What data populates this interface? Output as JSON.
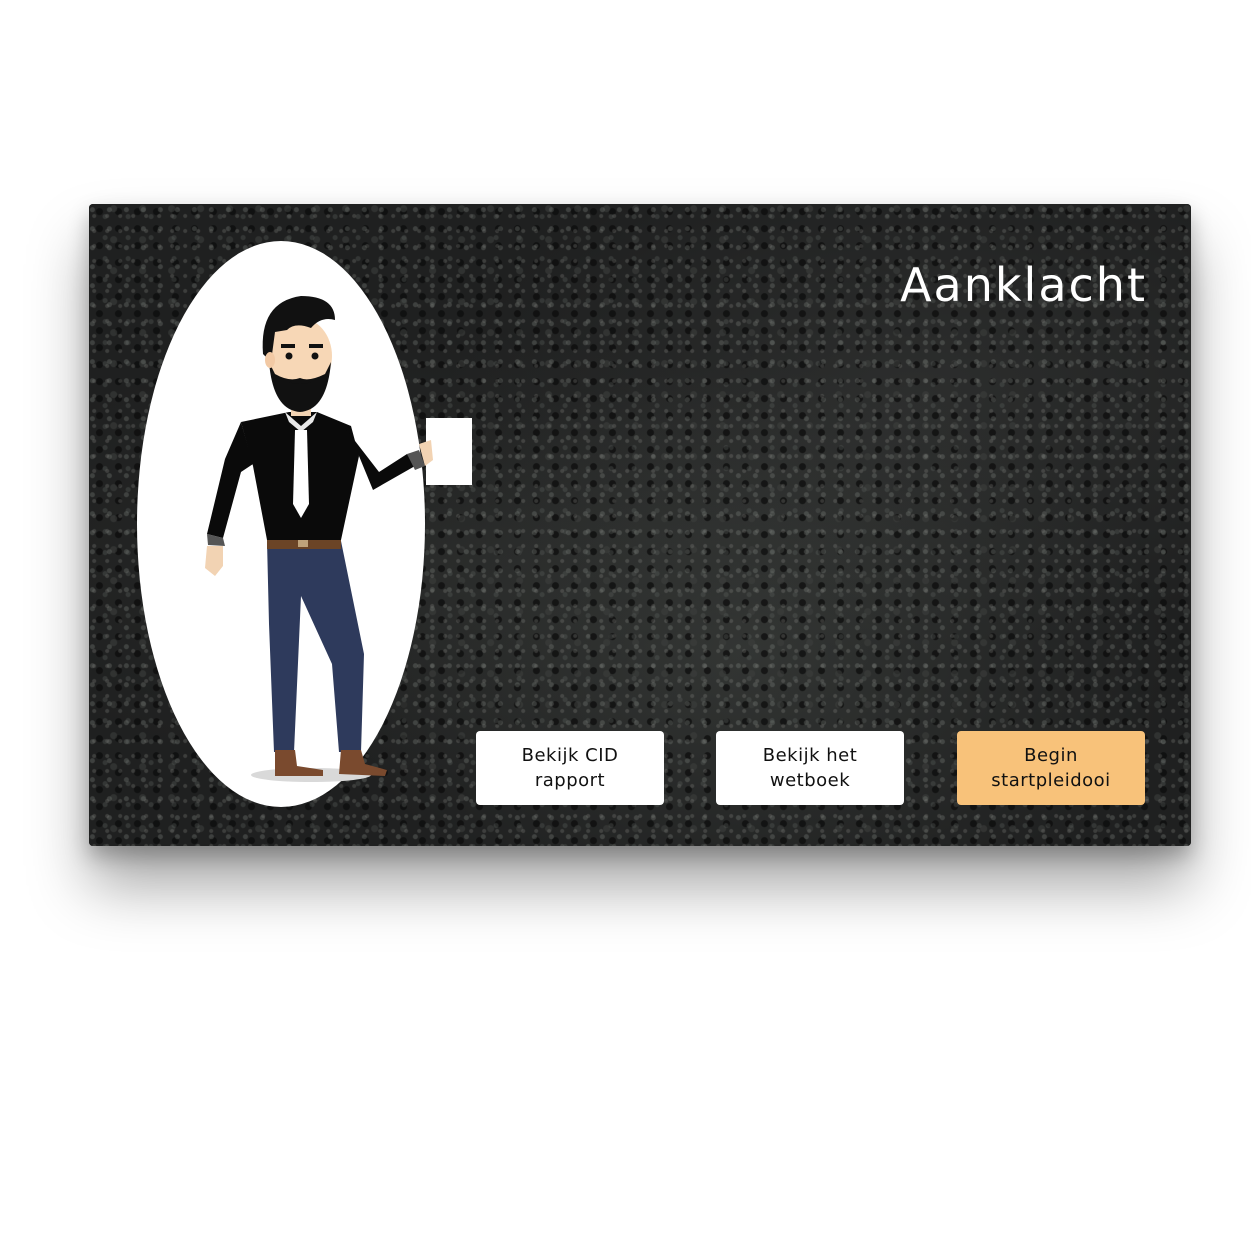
{
  "scene": {
    "title": "Aanklacht",
    "character": "man-holding-card"
  },
  "actions": {
    "cid_report": {
      "line1": "Bekijk CID",
      "line2": "rapport"
    },
    "lawbook": {
      "line1": "Bekijk het",
      "line2": "wetboek"
    },
    "start_plea": {
      "line1": "Begin",
      "line2": "startpleidooi"
    }
  },
  "colors": {
    "primary_button": "#f8c27a",
    "secondary_button": "#ffffff",
    "background": "#1f2020"
  }
}
